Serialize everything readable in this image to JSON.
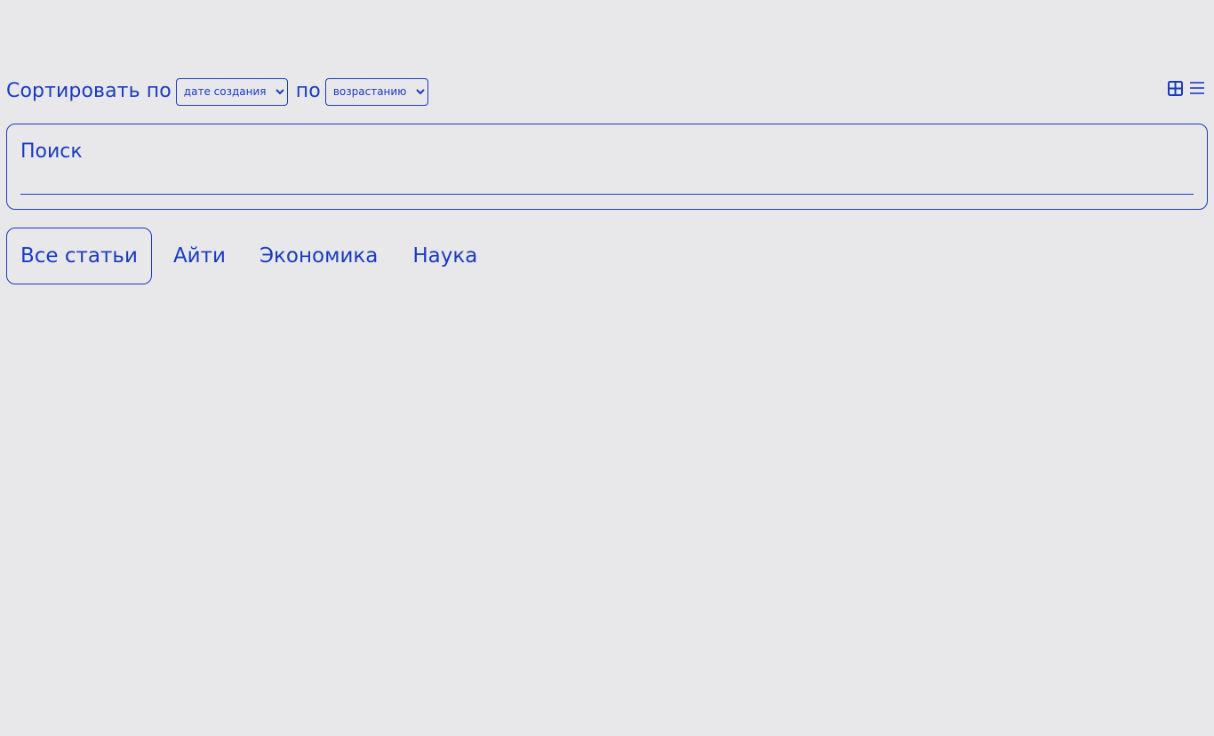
{
  "sort": {
    "label_prefix": "Сортировать по",
    "field_selected": "дате создания",
    "label_middle": "по",
    "order_selected": "возрастанию"
  },
  "view_toggle": {
    "icons": [
      "grid-icon",
      "list-icon"
    ],
    "accent_color": "#1a3bc0"
  },
  "search": {
    "label": "Поиск",
    "value": ""
  },
  "tabs": [
    {
      "label": "Все статьи",
      "active": true
    },
    {
      "label": "Айти",
      "active": false
    },
    {
      "label": "Экономика",
      "active": false
    },
    {
      "label": "Наука",
      "active": false
    }
  ],
  "colors": {
    "background": "#e8e8ea",
    "accent": "#1a3bc0"
  }
}
